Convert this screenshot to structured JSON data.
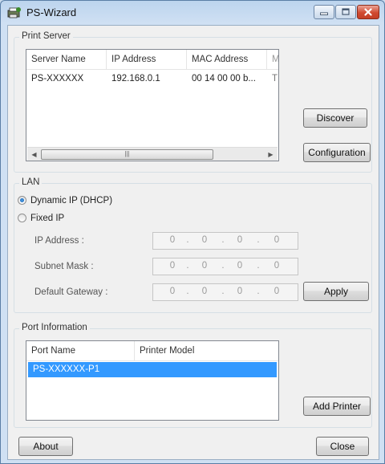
{
  "window": {
    "title": "PS-Wizard"
  },
  "print_server": {
    "group_title": "Print Server",
    "columns": [
      "Server Name",
      "IP Address",
      "MAC Address",
      "M"
    ],
    "rows": [
      {
        "server_name": "PS-XXXXXX",
        "ip": "192.168.0.1",
        "mac": "00 14 00 00 b...",
        "extra": "T"
      }
    ],
    "discover_label": "Discover",
    "configuration_label": "Configuration"
  },
  "lan": {
    "group_title": "LAN",
    "dhcp_label": "Dynamic IP (DHCP)",
    "fixed_label": "Fixed IP",
    "mode_selected": "dhcp",
    "ip_label": "IP Address :",
    "subnet_label": "Subnet Mask :",
    "gateway_label": "Default Gateway :",
    "ip_value": [
      "0",
      "0",
      "0",
      "0"
    ],
    "subnet_value": [
      "0",
      "0",
      "0",
      "0"
    ],
    "gateway_value": [
      "0",
      "0",
      "0",
      "0"
    ],
    "dot": ".",
    "apply_label": "Apply"
  },
  "port_info": {
    "group_title": "Port Information",
    "columns": [
      "Port Name",
      "Printer Model"
    ],
    "rows": [
      {
        "port_name": "PS-XXXXXX-P1",
        "printer_model": ""
      }
    ],
    "add_printer_label": "Add Printer"
  },
  "footer": {
    "about_label": "About",
    "close_label": "Close"
  },
  "colors": {
    "selection": "#3399ff",
    "close_button": "#c43f26"
  }
}
